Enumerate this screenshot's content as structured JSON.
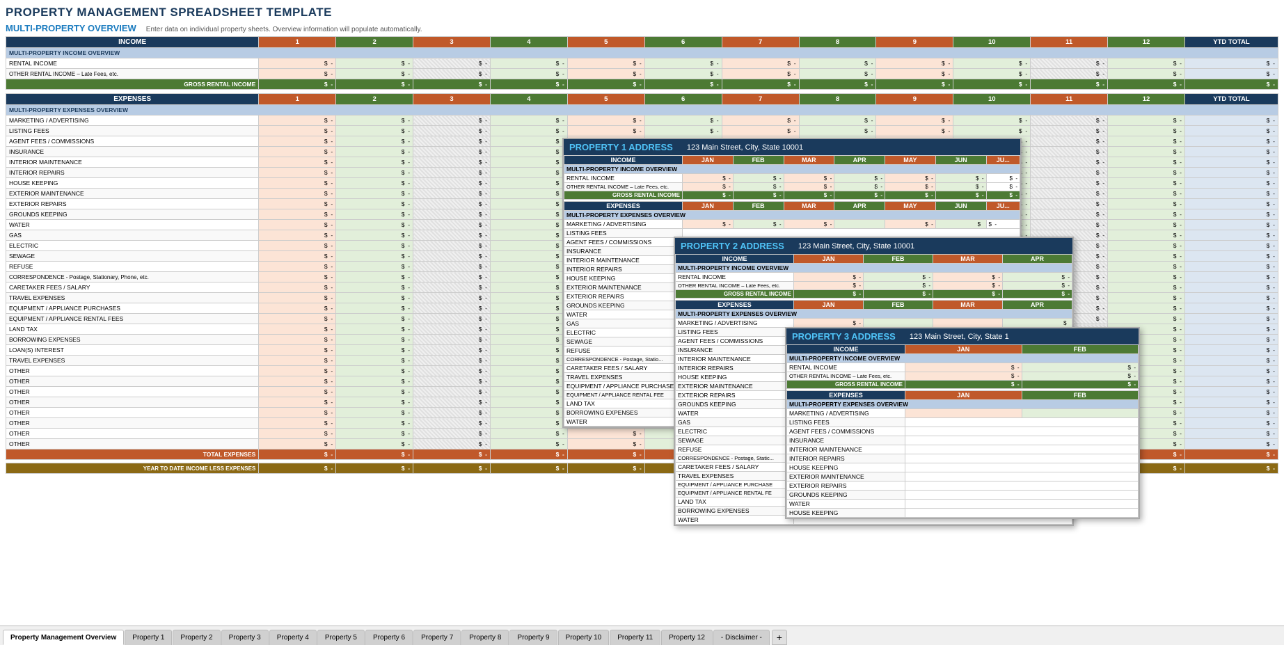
{
  "title": "PROPERTY MANAGEMENT SPREADSHEET TEMPLATE",
  "overview_title": "MULTI-PROPERTY OVERVIEW",
  "overview_subtitle": "Enter data on individual property sheets.  Overview information will populate automatically.",
  "income_section": {
    "header": "INCOME",
    "subsection": "MULTI-PROPERTY INCOME OVERVIEW",
    "rows": [
      "RENTAL INCOME",
      "OTHER RENTAL INCOME – Late Fees, etc."
    ],
    "gross_label": "GROSS RENTAL INCOME",
    "columns": [
      "1",
      "2",
      "3",
      "4",
      "5",
      "6",
      "7",
      "8",
      "9",
      "10",
      "11",
      "12",
      "YTD TOTAL"
    ]
  },
  "expenses_section": {
    "header": "EXPENSES",
    "subsection": "MULTI-PROPERTY EXPENSES OVERVIEW",
    "rows": [
      "MARKETING / ADVERTISING",
      "LISTING FEES",
      "AGENT FEES / COMMISSIONS",
      "INSURANCE",
      "INTERIOR MAINTENANCE",
      "INTERIOR REPAIRS",
      "HOUSE KEEPING",
      "EXTERIOR MAINTENANCE",
      "EXTERIOR REPAIRS",
      "GROUNDS KEEPING",
      "WATER",
      "GAS",
      "ELECTRIC",
      "SEWAGE",
      "REFUSE",
      "CORRESPONDENCE - Postage, Stationary, Phone, etc.",
      "CARETAKER FEES / SALARY",
      "TRAVEL EXPENSES",
      "EQUIPMENT / APPLIANCE PURCHASES",
      "EQUIPMENT / APPLIANCE RENTAL FEES",
      "LAND TAX",
      "BORROWING EXPENSES",
      "LOAN(S) INTEREST",
      "TRAVEL EXPENSES",
      "OTHER",
      "OTHER",
      "OTHER",
      "OTHER",
      "OTHER",
      "OTHER",
      "OTHER",
      "OTHER"
    ],
    "total_label": "TOTAL EXPENSES",
    "ytd_label": "YEAR TO DATE INCOME LESS EXPENSES"
  },
  "property1": {
    "title": "PROPERTY 1 ADDRESS",
    "address": "123 Main Street, City, State  10001",
    "months": [
      "JAN",
      "FEB",
      "MAR",
      "APR",
      "MAY",
      "JUN",
      "JU"
    ]
  },
  "property2": {
    "title": "PROPERTY 2 ADDRESS",
    "address": "123 Main Street, City, State  10001",
    "months": [
      "JAN",
      "FEB",
      "MAR",
      "APR"
    ]
  },
  "property3": {
    "title": "PROPERTY 3 ADDRESS",
    "address": "123 Main Street, City, State  1",
    "months": [
      "JAN",
      "FEB"
    ]
  },
  "tabs": [
    {
      "label": "Property Management Overview",
      "active": true
    },
    {
      "label": "Property 1",
      "active": false
    },
    {
      "label": "Property 2",
      "active": false
    },
    {
      "label": "Property 3",
      "active": false
    },
    {
      "label": "Property 4",
      "active": false
    },
    {
      "label": "Property 5",
      "active": false
    },
    {
      "label": "Property 6",
      "active": false
    },
    {
      "label": "Property 7",
      "active": false
    },
    {
      "label": "Property 8",
      "active": false
    },
    {
      "label": "Property 9",
      "active": false
    },
    {
      "label": "Property 10",
      "active": false
    },
    {
      "label": "Property 11",
      "active": false
    },
    {
      "label": "Property 12",
      "active": false
    },
    {
      "label": "- Disclaimer -",
      "active": false
    }
  ],
  "prop_expenses_overview": "Property EXPENSES Overview"
}
